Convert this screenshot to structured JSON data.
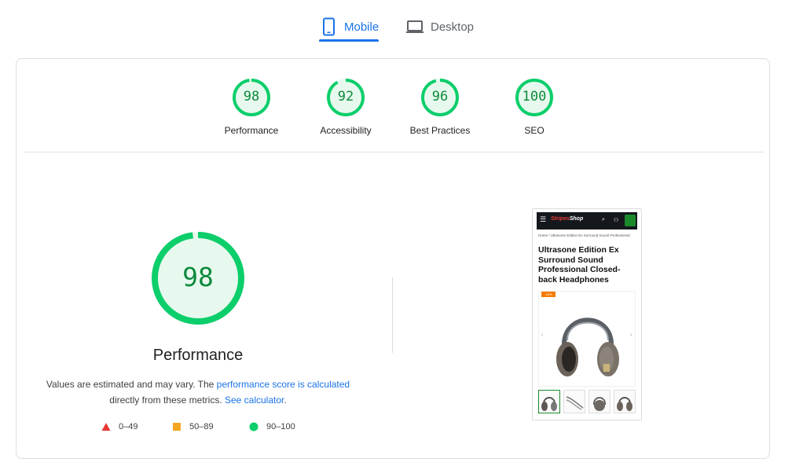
{
  "tabs": {
    "mobile": "Mobile",
    "desktop": "Desktop",
    "active": "mobile"
  },
  "scores": [
    {
      "label": "Performance",
      "value": 98
    },
    {
      "label": "Accessibility",
      "value": 92
    },
    {
      "label": "Best Practices",
      "value": 96
    },
    {
      "label": "SEO",
      "value": 100
    }
  ],
  "main": {
    "score": 98,
    "title": "Performance",
    "note_part1": "Values are estimated and may vary. The ",
    "note_link1": "performance score is calculated",
    "note_part2": " directly from these metrics. ",
    "note_link2": "See calculator",
    "note_part3": "."
  },
  "legend": [
    {
      "range": "0–49",
      "shape": "triangle",
      "color": "#e53935"
    },
    {
      "range": "50–89",
      "shape": "square",
      "color": "#f4a623"
    },
    {
      "range": "90–100",
      "shape": "circle",
      "color": "#0cce6b"
    }
  ],
  "colors": {
    "pass": "#0cce6b",
    "pass_text": "#0d8a3c",
    "pass_bg": "#e7f9ee",
    "accent": "#1a73e8"
  },
  "screenshot": {
    "logo_main": "Stripes",
    "logo_sub": "Shop",
    "breadcrumb": "Home /  Ultrasone Edition Ex Surround Sound Professional",
    "product_title": "Ultrasone Edition Ex Surround Sound Professional Closed-back Headphones",
    "badge": "-16%"
  }
}
